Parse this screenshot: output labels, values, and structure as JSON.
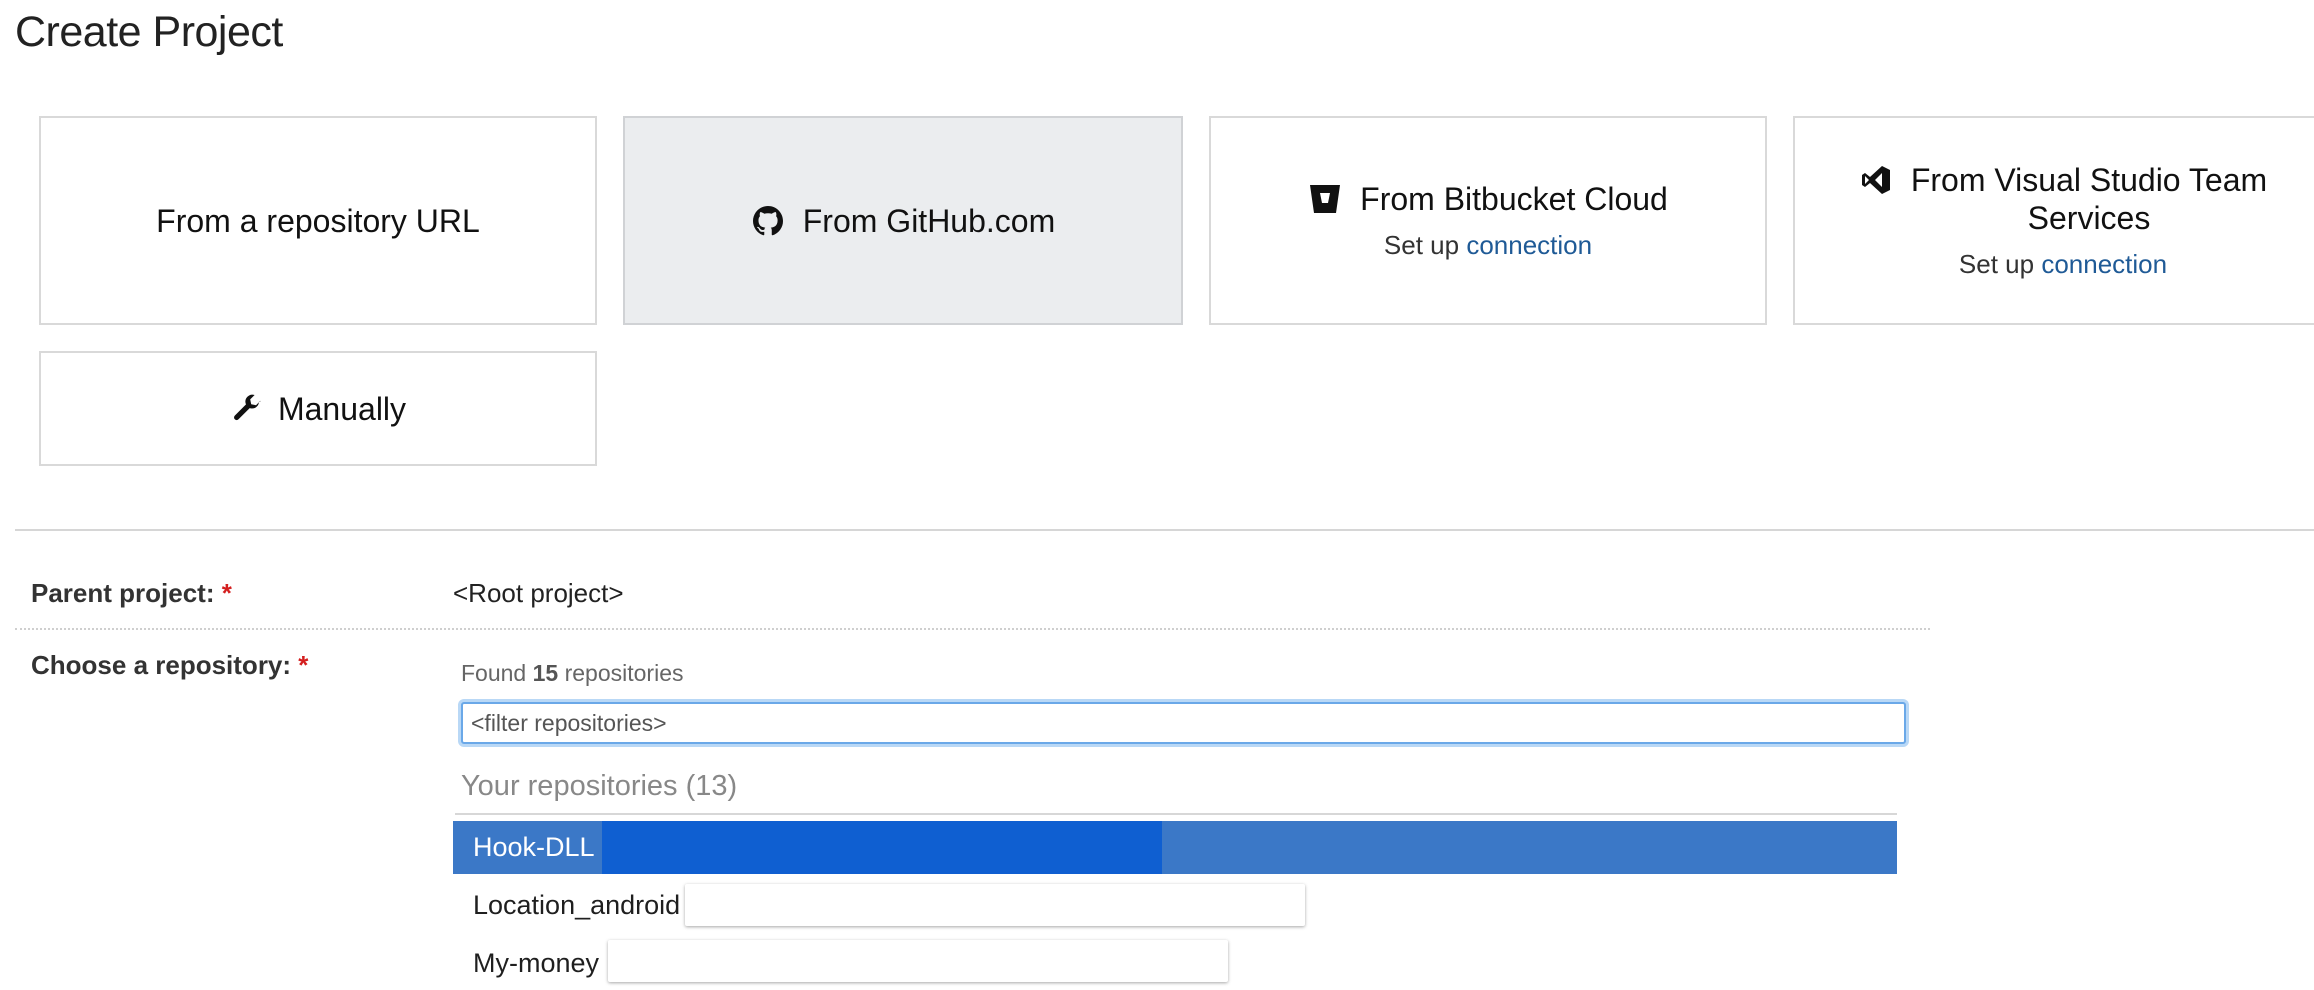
{
  "page": {
    "title": "Create Project"
  },
  "cards": [
    {
      "label": "From a repository URL"
    },
    {
      "label": "From GitHub.com",
      "icon": "github-icon",
      "active": true
    },
    {
      "label": "From Bitbucket Cloud",
      "icon": "bitbucket-icon",
      "sub_prefix": "Set up",
      "sub_link": "connection"
    },
    {
      "label_line1": "From Visual Studio Team",
      "label_line2": "Services",
      "icon": "visual-studio-icon",
      "sub_prefix": "Set up",
      "sub_link": "connection"
    },
    {
      "label": "Manually",
      "icon": "wrench-icon"
    }
  ],
  "form": {
    "parent_label": "Parent project:",
    "required_mark": "*",
    "parent_value": "<Root project>",
    "repo_label": "Choose a repository:",
    "found_prefix": "Found",
    "found_count": "15",
    "found_suffix": "repositories",
    "filter_placeholder": "<filter repositories>",
    "group_title": "Your repositories (13)",
    "repos": [
      "Hook-DLL",
      "Location_android",
      "My-money"
    ]
  },
  "colors": {
    "link": "#1f5a96",
    "selected_row": "#3b78c7",
    "required": "#d41f1f"
  }
}
